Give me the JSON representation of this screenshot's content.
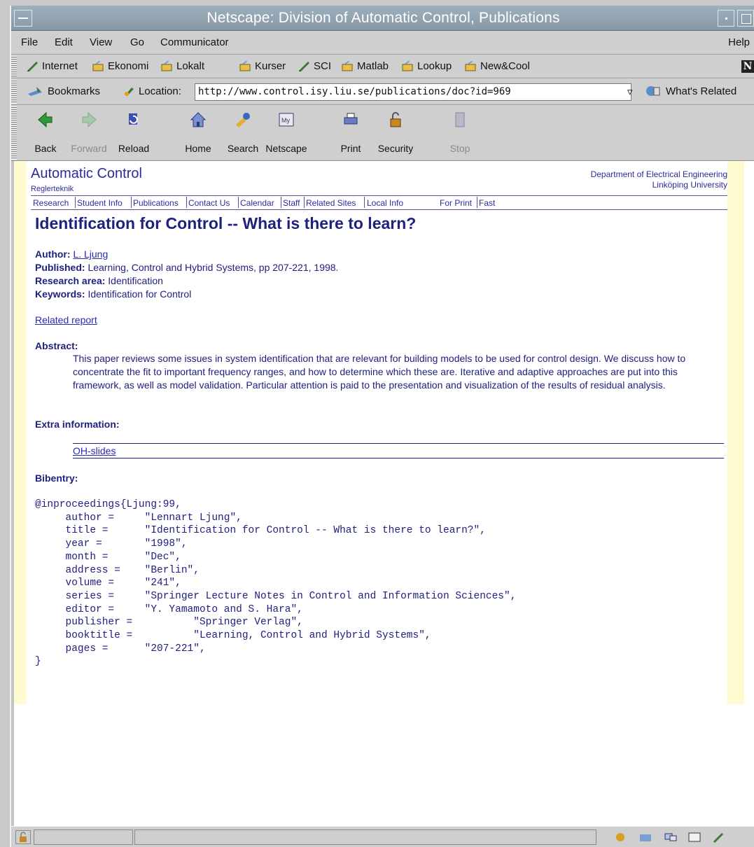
{
  "window": {
    "title": "Netscape: Division of Automatic Control, Publications"
  },
  "menu": {
    "file": "File",
    "edit": "Edit",
    "view": "View",
    "go": "Go",
    "communicator": "Communicator",
    "help": "Help"
  },
  "personal_toolbar": {
    "items": [
      "Internet",
      "Ekonomi",
      "Lokalt",
      "Kurser",
      "SCI",
      "Matlab",
      "Lookup",
      "New&Cool"
    ]
  },
  "location_bar": {
    "bookmarks": "Bookmarks",
    "location_label": "Location:",
    "url": "http://www.control.isy.liu.se/publications/doc?id=969",
    "whats_related": "What's Related"
  },
  "nav_toolbar": {
    "back": "Back",
    "forward": "Forward",
    "reload": "Reload",
    "home": "Home",
    "search": "Search",
    "netscape": "Netscape",
    "print": "Print",
    "security": "Security",
    "stop": "Stop"
  },
  "site": {
    "title": "Automatic Control",
    "subtitle": "Reglerteknik",
    "dept_line1": "Department of Electrical Engineering",
    "dept_line2": "Linköping University",
    "nav": [
      "Research",
      "Student Info",
      "Publications",
      "Contact Us",
      "Calendar",
      "Staff",
      "Related Sites",
      "Local Info",
      "For Print",
      "Fast"
    ]
  },
  "publication": {
    "title": "Identification for Control -- What is there to learn?",
    "author_label": "Author:",
    "author": "L. Ljung",
    "published_label": "Published:",
    "published": "Learning, Control and Hybrid Systems, pp 207-221, 1998.",
    "research_area_label": "Research area:",
    "research_area": "Identification",
    "keywords_label": "Keywords:",
    "keywords": "Identification for Control",
    "related_report": "Related report",
    "abstract_label": "Abstract:",
    "abstract": "This paper reviews some issues in system identification that are relevant for building models to be used for control design. We discuss how to concentrate the fit to important frequency ranges, and how to determine which these are. Iterative and adaptive approaches are put into this framework, as well as model validation. Particular attention is paid to the presentation and visualization of the results of residual analysis.",
    "extra_label": "Extra information:",
    "extra_link": "OH-slides",
    "bibentry_label": "Bibentry:",
    "bibentry": "@inproceedings{Ljung:99,\n     author =     \"Lennart Ljung\",\n     title =      \"Identification for Control -- What is there to learn?\",\n     year =       \"1998\",\n     month =      \"Dec\",\n     address =    \"Berlin\",\n     volume =     \"241\",\n     series =     \"Springer Lecture Notes in Control and Information Sciences\",\n     editor =     \"Y. Yamamoto and S. Hara\",\n     publisher =          \"Springer Verlag\",\n     booktitle =          \"Learning, Control and Hybrid Systems\",\n     pages =      \"207-221\",\n}"
  }
}
